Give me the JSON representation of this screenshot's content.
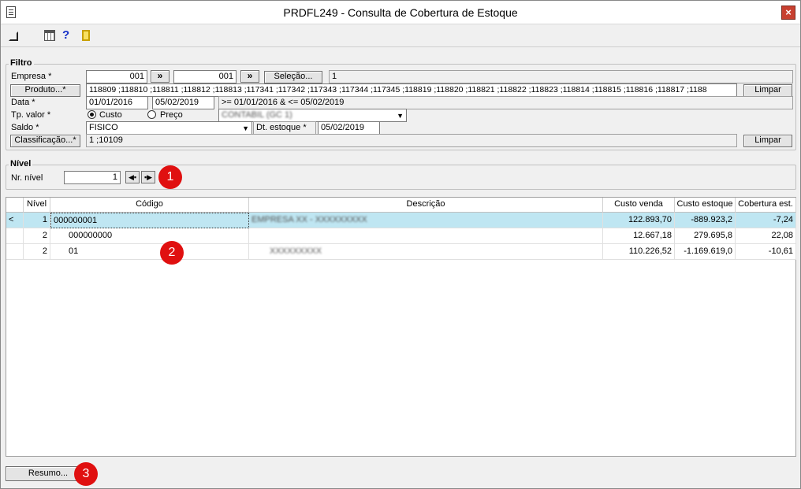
{
  "window": {
    "title": "PRDFL249 - Consulta de Cobertura de Estoque",
    "close": "×"
  },
  "toolbar": {
    "help_glyph": "?"
  },
  "filtro": {
    "title": "Filtro",
    "empresa_label": "Empresa *",
    "empresa_from": "001",
    "empresa_to": "001",
    "range_glyph": "»",
    "selecao_button": "Seleção...",
    "selecao_value": "1",
    "produto_button": "Produto...*",
    "produto_value": "118809 ;118810 ;118811 ;118812 ;118813 ;117341 ;117342 ;117343 ;117344 ;117345 ;118819 ;118820 ;118821 ;118822 ;118823 ;118814 ;118815 ;118816 ;118817 ;1188",
    "limpar_label": "Limpar",
    "data_label": "Data *",
    "data_from": "01/01/2016",
    "data_to": "05/02/2019",
    "data_expr": ">= 01/01/2016 & <= 05/02/2019",
    "tpvalor_label": "Tp. valor *",
    "custo_label": "Custo",
    "preco_label": "Preço",
    "tpvalor_select": "CONTABIL (GC 1)",
    "saldo_label": "Saldo *",
    "saldo_value": "FISICO",
    "dtestoque_label": "Dt. estoque *",
    "dtestoque_value": "05/02/2019",
    "classificacao_button": "Classificação...*",
    "classificacao_value": "1 ;10109",
    "limpar2_label": "Limpar"
  },
  "nivel": {
    "title": "Nível",
    "nr_label": "Nr. nível",
    "nr_value": "1"
  },
  "markers": {
    "m1": "1",
    "m2": "2",
    "m3": "3"
  },
  "grid": {
    "headers": [
      "",
      "Nível",
      "Código",
      "Descrição",
      "Custo venda",
      "Custo estoque",
      "Cobertura est."
    ],
    "rows": [
      {
        "ind": "<",
        "nivel": "1",
        "codigo": "000000001",
        "descricao": "EMPRESA XX - XXXXXXXXX",
        "custo_venda": "122.893,70",
        "custo_estoque": "-889.923,2",
        "cobertura": "-7,24"
      },
      {
        "ind": "",
        "nivel": "2",
        "codigo": "000000000",
        "descricao": "",
        "custo_venda": "12.667,18",
        "custo_estoque": "279.695,8",
        "cobertura": "22,08"
      },
      {
        "ind": "",
        "nivel": "2",
        "codigo": "01",
        "descricao": "XXXXXXXXX",
        "custo_venda": "110.226,52",
        "custo_estoque": "-1.169.619,0",
        "cobertura": "-10,61"
      }
    ]
  },
  "footer": {
    "resumo_button": "Resumo..."
  }
}
